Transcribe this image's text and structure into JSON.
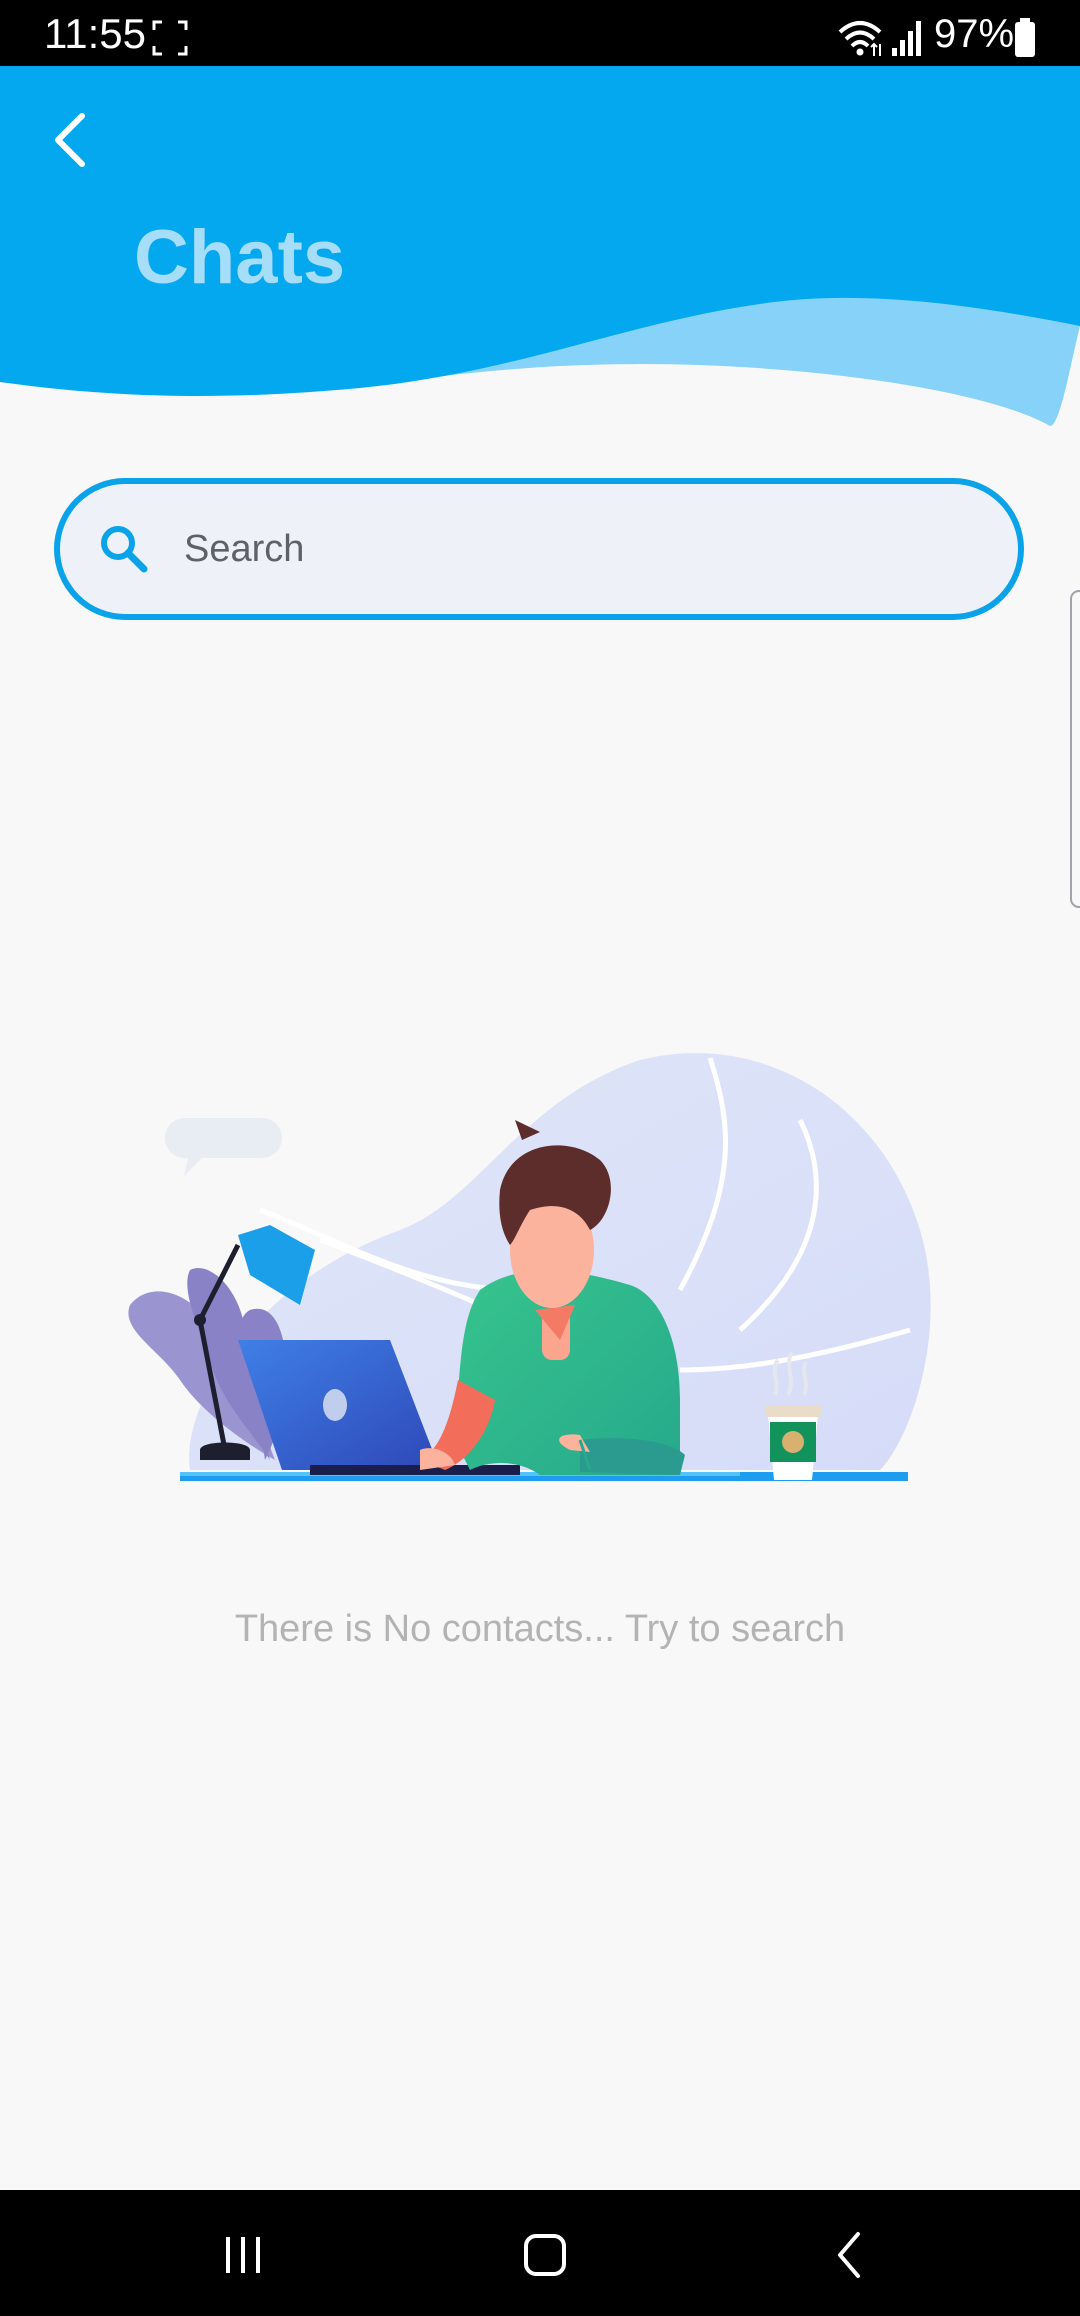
{
  "status_bar": {
    "time": "11:55",
    "battery": "97%",
    "icons": [
      "screenshot-icon",
      "wifi-icon",
      "signal-icon",
      "battery-icon"
    ]
  },
  "header": {
    "title": "Chats",
    "back_icon": "chevron-left-icon"
  },
  "search": {
    "placeholder": "Search",
    "icon": "search-icon"
  },
  "empty_state": {
    "message": "There is No contacts... Try to search"
  },
  "nav_bar": {
    "icons": [
      "recent-apps-icon",
      "home-icon",
      "back-icon"
    ]
  },
  "colors": {
    "header_blue": "#04a8ef",
    "wave_light": "#86d2f8",
    "title_color": "#a6ddf8",
    "search_border": "#0aa3ea",
    "background": "#f8f8f8"
  }
}
